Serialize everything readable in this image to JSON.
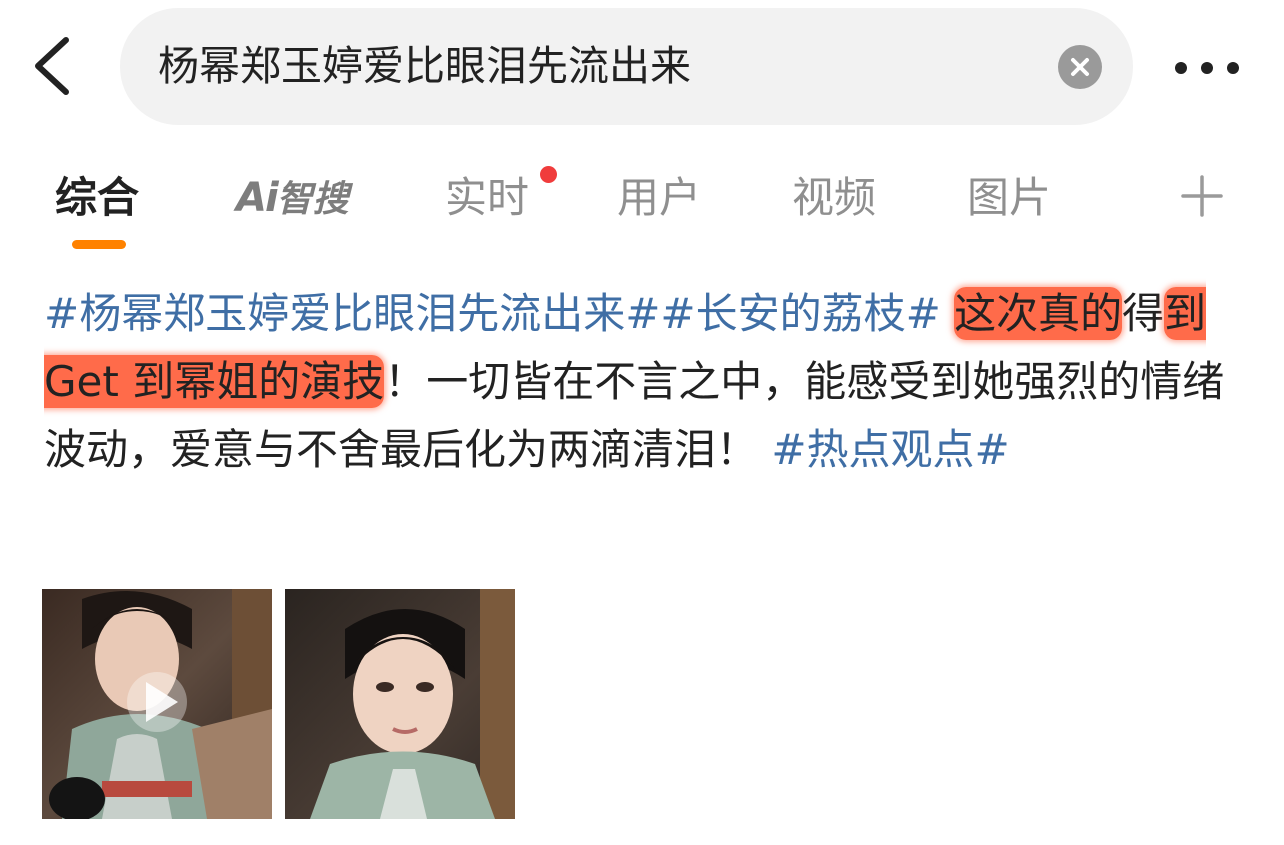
{
  "header": {
    "back_icon": "chevron-left-icon",
    "search_value": "杨幂郑玉婷爱比眼泪先流出来",
    "clear_icon": "close-circle-icon",
    "more_icon": "more-horizontal-icon"
  },
  "tabs": [
    {
      "label": "综合",
      "active": true
    },
    {
      "label_ai": "Ai",
      "label_rest": "智搜"
    },
    {
      "label": "实时",
      "badge": "red-dot"
    },
    {
      "label": "用户"
    },
    {
      "label": "视频"
    },
    {
      "label": "图片"
    }
  ],
  "tabs_more_icon": "plus-icon",
  "post": {
    "tag1": "#杨幂郑玉婷爱比眼泪先流出来#",
    "tag2": "#长安的荔枝#",
    "t1": " ",
    "hl1": "这次真的",
    "t2": "得",
    "hl2": "到 Get 到幂姐的演技",
    "t3": "！一切皆在不言之中，能感受到她强烈的情绪波动，爱意与不舍最后化为两滴清泪！ ",
    "tag3": "#热点观点#"
  },
  "media": [
    {
      "type": "video",
      "icon": "play-icon"
    },
    {
      "type": "image"
    }
  ],
  "colors": {
    "accent": "#ff8200",
    "link": "#3f6ea5",
    "highlight": "#ff6b4a",
    "badge": "#f03c3c"
  }
}
